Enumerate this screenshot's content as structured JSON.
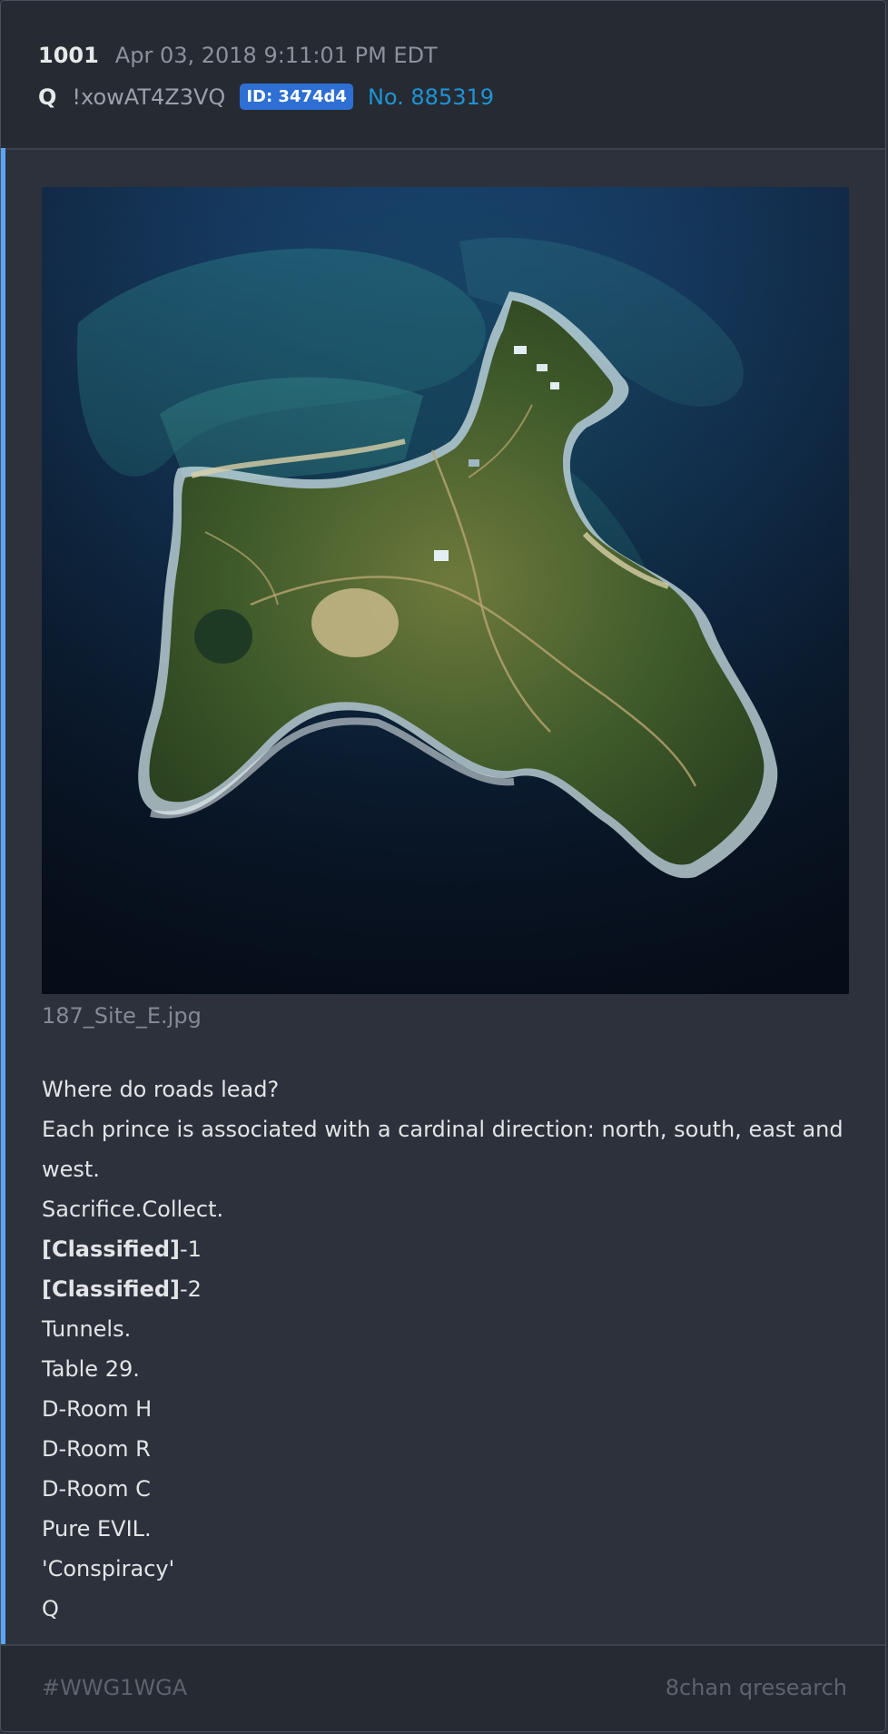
{
  "post": {
    "number": "1001",
    "date": "Apr 03, 2018 9:11:01 PM EDT",
    "author": "Q",
    "tripcode": "!xowAT4Z3VQ",
    "id_badge": "ID: 3474d4",
    "post_no": "No. 885319"
  },
  "image": {
    "filename": "187_Site_E.jpg"
  },
  "body": {
    "line1": "Where do roads lead?",
    "line2": "Each prince is associated with a cardinal direction: north, south, east and west.",
    "line3": "Sacrifice.Collect.",
    "line4_bold": "[Classified]",
    "line4_rest": "-1",
    "line5_bold": "[Classified]",
    "line5_rest": "-2",
    "line6": "Tunnels.",
    "line7": "Table 29.",
    "line8": "D-Room H",
    "line9": "D-Room R",
    "line10": "D-Room C",
    "line11": "Pure EVIL.",
    "line12": "'Conspiracy'",
    "line13": "Q"
  },
  "footer": {
    "hashtag": "#WWG1WGA",
    "source": "8chan qresearch"
  },
  "colors": {
    "accent_bar": "#5aa5f5",
    "id_badge": "#2d6fd2",
    "post_link": "#1e94d6"
  }
}
